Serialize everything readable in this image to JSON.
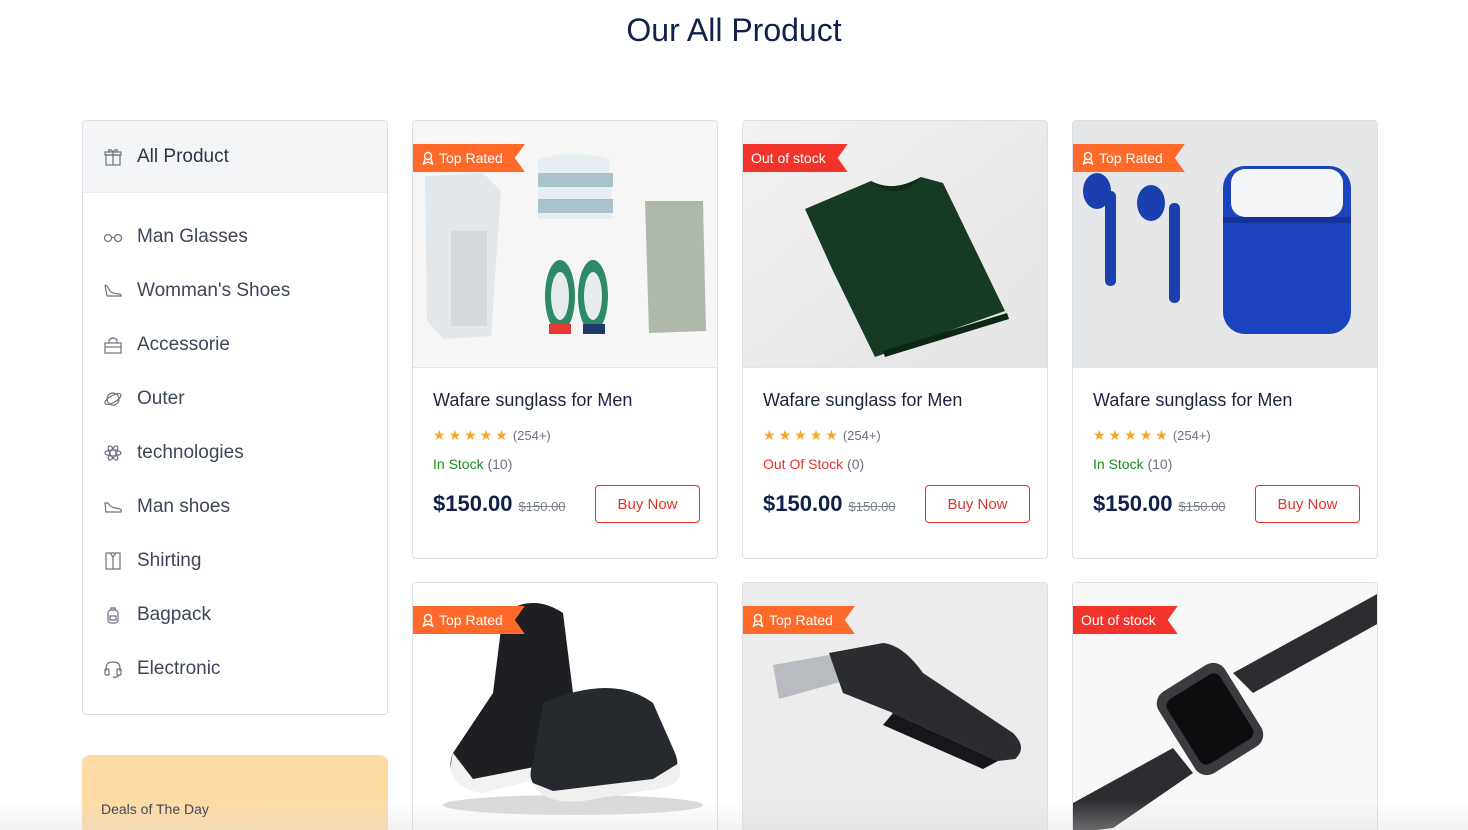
{
  "page": {
    "title": "Our All Product"
  },
  "sidebar": {
    "head": {
      "label": "All Product",
      "icon": "gift-icon"
    },
    "items": [
      {
        "label": "Man Glasses",
        "icon": "glasses-icon"
      },
      {
        "label": "Womman's Shoes",
        "icon": "heel-shoe-icon"
      },
      {
        "label": "Accessorie",
        "icon": "bag-icon"
      },
      {
        "label": "Outer",
        "icon": "planet-icon"
      },
      {
        "label": "technologies",
        "icon": "atom-icon"
      },
      {
        "label": "Man shoes",
        "icon": "sneaker-icon"
      },
      {
        "label": "Shirting",
        "icon": "shirt-icon"
      },
      {
        "label": "Bagpack",
        "icon": "backpack-icon"
      },
      {
        "label": "Electronic",
        "icon": "headset-icon"
      }
    ]
  },
  "deals": {
    "label": "Deals of The Day",
    "subtitle": ""
  },
  "products": [
    {
      "badge": "Top Rated",
      "badge_type": "top",
      "title": "Wafare sunglass for Men",
      "rating_count": "(254+)",
      "stock_label": "In Stock",
      "stock_type": "in",
      "stock_qty": "(10)",
      "price": "$150.00",
      "old_price": "$150.00",
      "button": "Buy Now",
      "image": "clothes-flatlay"
    },
    {
      "badge": "Out of stock",
      "badge_type": "out",
      "title": "Wafare sunglass for Men",
      "rating_count": "(254+)",
      "stock_label": "Out Of Stock",
      "stock_type": "out",
      "stock_qty": "(0)",
      "price": "$150.00",
      "old_price": "$150.00",
      "button": "Buy Now",
      "image": "green-tshirt"
    },
    {
      "badge": "Top Rated",
      "badge_type": "top",
      "title": "Wafare sunglass for Men",
      "rating_count": "(254+)",
      "stock_label": "In Stock",
      "stock_type": "in",
      "stock_qty": "(10)",
      "price": "$150.00",
      "old_price": "$150.00",
      "button": "Buy Now",
      "image": "blue-earbuds"
    },
    {
      "badge": "Top Rated",
      "badge_type": "top",
      "image": "black-sneakers"
    },
    {
      "badge": "Top Rated",
      "badge_type": "top",
      "image": "hair-trimmer"
    },
    {
      "badge": "Out of stock",
      "badge_type": "out",
      "image": "smartwatch"
    }
  ],
  "colors": {
    "accent": "#e5332b",
    "top_rated": "#ff6a2a",
    "out_of_stock": "#f2332b",
    "in_stock": "#1e8a1e",
    "star": "#f5a623",
    "deals_bg": "#fddba3"
  }
}
